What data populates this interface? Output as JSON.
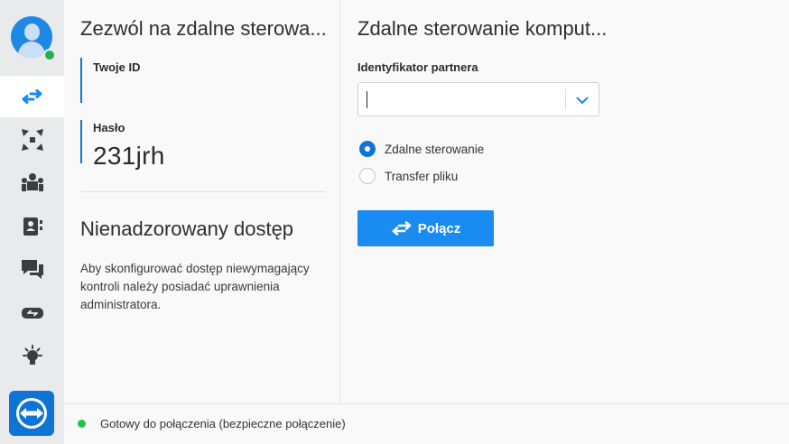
{
  "sidebar": {
    "items": [
      {
        "icon": "remote-control-icon",
        "active": true
      },
      {
        "icon": "meeting-icon",
        "active": false
      },
      {
        "icon": "team-icon",
        "active": false
      },
      {
        "icon": "contacts-icon",
        "active": false
      },
      {
        "icon": "chat-icon",
        "active": false
      },
      {
        "icon": "augmented-reality-icon",
        "active": false
      },
      {
        "icon": "lightbulb-icon",
        "active": false
      }
    ],
    "logo": "teamviewer-logo-icon",
    "status_color": "#22b14c"
  },
  "left": {
    "title": "Zezwól na zdalne sterowa...",
    "id_label": "Twoje ID",
    "id_value": "",
    "password_label": "Hasło",
    "password_value": "231jrh",
    "unattended_title": "Nienadzorowany dostęp",
    "unattended_desc": "Aby skonfigurować dostęp niewymagający kontroli należy posiadać uprawnienia administratora."
  },
  "right": {
    "title": "Zdalne sterowanie komput...",
    "partner_label": "Identyfikator partnera",
    "partner_value": "",
    "radios": [
      {
        "label": "Zdalne sterowanie",
        "selected": true
      },
      {
        "label": "Transfer pliku",
        "selected": false
      }
    ],
    "connect_label": "Połącz"
  },
  "status": {
    "text": "Gotowy do połączenia (bezpieczne połączenie)",
    "color": "#22c24a"
  },
  "colors": {
    "accent": "#0e75d6",
    "button": "#1a8bf0",
    "sidebar_bg": "#e9eaec"
  }
}
